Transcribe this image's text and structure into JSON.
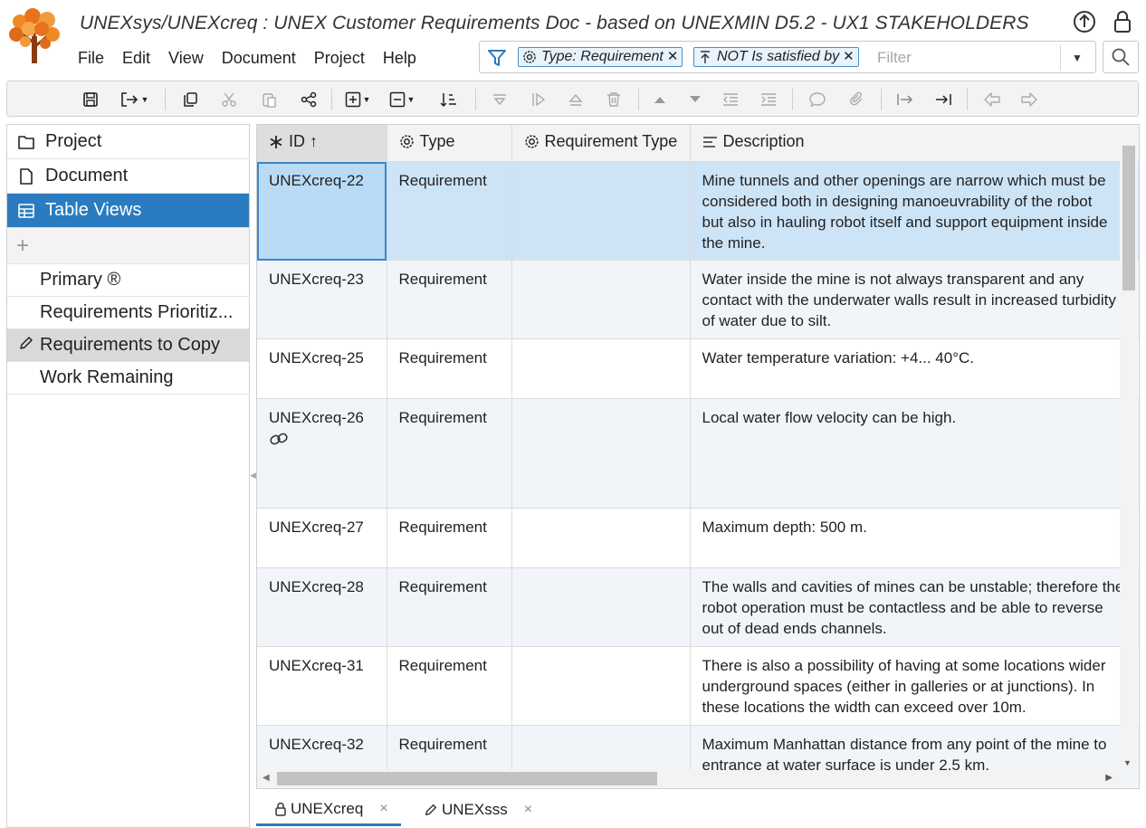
{
  "header": {
    "title": "UNEXsys/UNEXcreq : UNEX Customer Requirements Doc - based on UNEXMIN D5.2 - UX1 STAKEHOLDERS",
    "upload_icon": "upload-circle-icon",
    "lock_icon": "lock-icon"
  },
  "menu": [
    "File",
    "Edit",
    "View",
    "Document",
    "Project",
    "Help"
  ],
  "filter": {
    "chips": [
      {
        "icon": "gear-icon",
        "label": "Type: Requirement"
      },
      {
        "icon": "arrow-up-bar-icon",
        "label": "NOT Is satisfied by"
      }
    ],
    "placeholder": "Filter"
  },
  "toolbar_icons": [
    "save-icon",
    "export-icon",
    "copy-icon",
    "cut-icon",
    "paste-icon",
    "share-icon",
    "add-icon",
    "remove-icon",
    "sort-icon",
    "filter-down-icon",
    "play-icon",
    "eject-icon",
    "trash-icon",
    "move-up-icon",
    "move-down-icon",
    "outdent-icon",
    "indent-icon",
    "comment-icon",
    "attachment-icon",
    "goto-start-icon",
    "goto-end-icon",
    "back-icon",
    "forward-icon"
  ],
  "left_panel": {
    "sections": [
      {
        "icon": "folder-icon",
        "label": "Project"
      },
      {
        "icon": "document-icon",
        "label": "Document"
      },
      {
        "icon": "table-icon",
        "label": "Table Views"
      }
    ],
    "add_label": "+",
    "views": [
      {
        "label": "Primary ®",
        "active": false
      },
      {
        "label": "Requirements Prioritiz...",
        "active": false
      },
      {
        "label": "Requirements to Copy",
        "active": true
      },
      {
        "label": "Work Remaining",
        "active": false
      }
    ]
  },
  "table": {
    "columns": [
      {
        "icon": "asterisk-icon",
        "label": "ID ↑"
      },
      {
        "icon": "gear-icon",
        "label": "Type"
      },
      {
        "icon": "gear-icon",
        "label": "Requirement Type"
      },
      {
        "icon": "paragraph-icon",
        "label": "Description"
      }
    ],
    "rows": [
      {
        "id": "UNEXcreq-22",
        "type": "Requirement",
        "req_type": "",
        "desc": [
          "Mine tunnels and other openings are narrow which must be",
          "considered both in designing manoeuvrability of the robot",
          "but also in hauling robot itself and support equipment inside",
          "the mine."
        ]
      },
      {
        "id": "UNEXcreq-23",
        "type": "Requirement",
        "req_type": "",
        "desc": [
          "Water inside the mine is not always transparent and any",
          "contact with the underwater walls result in increased turbidity",
          "of water due to silt."
        ]
      },
      {
        "id": "UNEXcreq-25",
        "type": "Requirement",
        "req_type": "",
        "desc": [
          "Water temperature variation: +4... 40°C."
        ]
      },
      {
        "id": "UNEXcreq-26",
        "type": "Requirement",
        "req_type": "",
        "desc": [
          "Local water flow velocity can be high."
        ]
      },
      {
        "id": "UNEXcreq-27",
        "type": "Requirement",
        "req_type": "",
        "desc": [
          "Maximum depth: 500 m."
        ]
      },
      {
        "id": "UNEXcreq-28",
        "type": "Requirement",
        "req_type": "",
        "desc": [
          "The walls and cavities of mines can be unstable; therefore the",
          "robot operation must be contactless and be able to reverse",
          "out of dead ends channels."
        ]
      },
      {
        "id": "UNEXcreq-31",
        "type": "Requirement",
        "req_type": "",
        "desc": [
          "There is also a possibility of having at some locations wider",
          "underground spaces (either in galleries or at junctions). In",
          "these locations the width can exceed over 10m."
        ]
      },
      {
        "id": "UNEXcreq-32",
        "type": "Requirement",
        "req_type": "",
        "desc": [
          "Maximum Manhattan distance from any point of the mine to",
          "entrance at water surface is under 2.5 km."
        ]
      }
    ]
  },
  "bottom_tabs": [
    {
      "icon": "lock-icon",
      "label": "UNEXcreq",
      "close": "×",
      "active": true
    },
    {
      "icon": "pencil-icon",
      "label": "UNEXsss",
      "close": "×",
      "active": false
    }
  ]
}
